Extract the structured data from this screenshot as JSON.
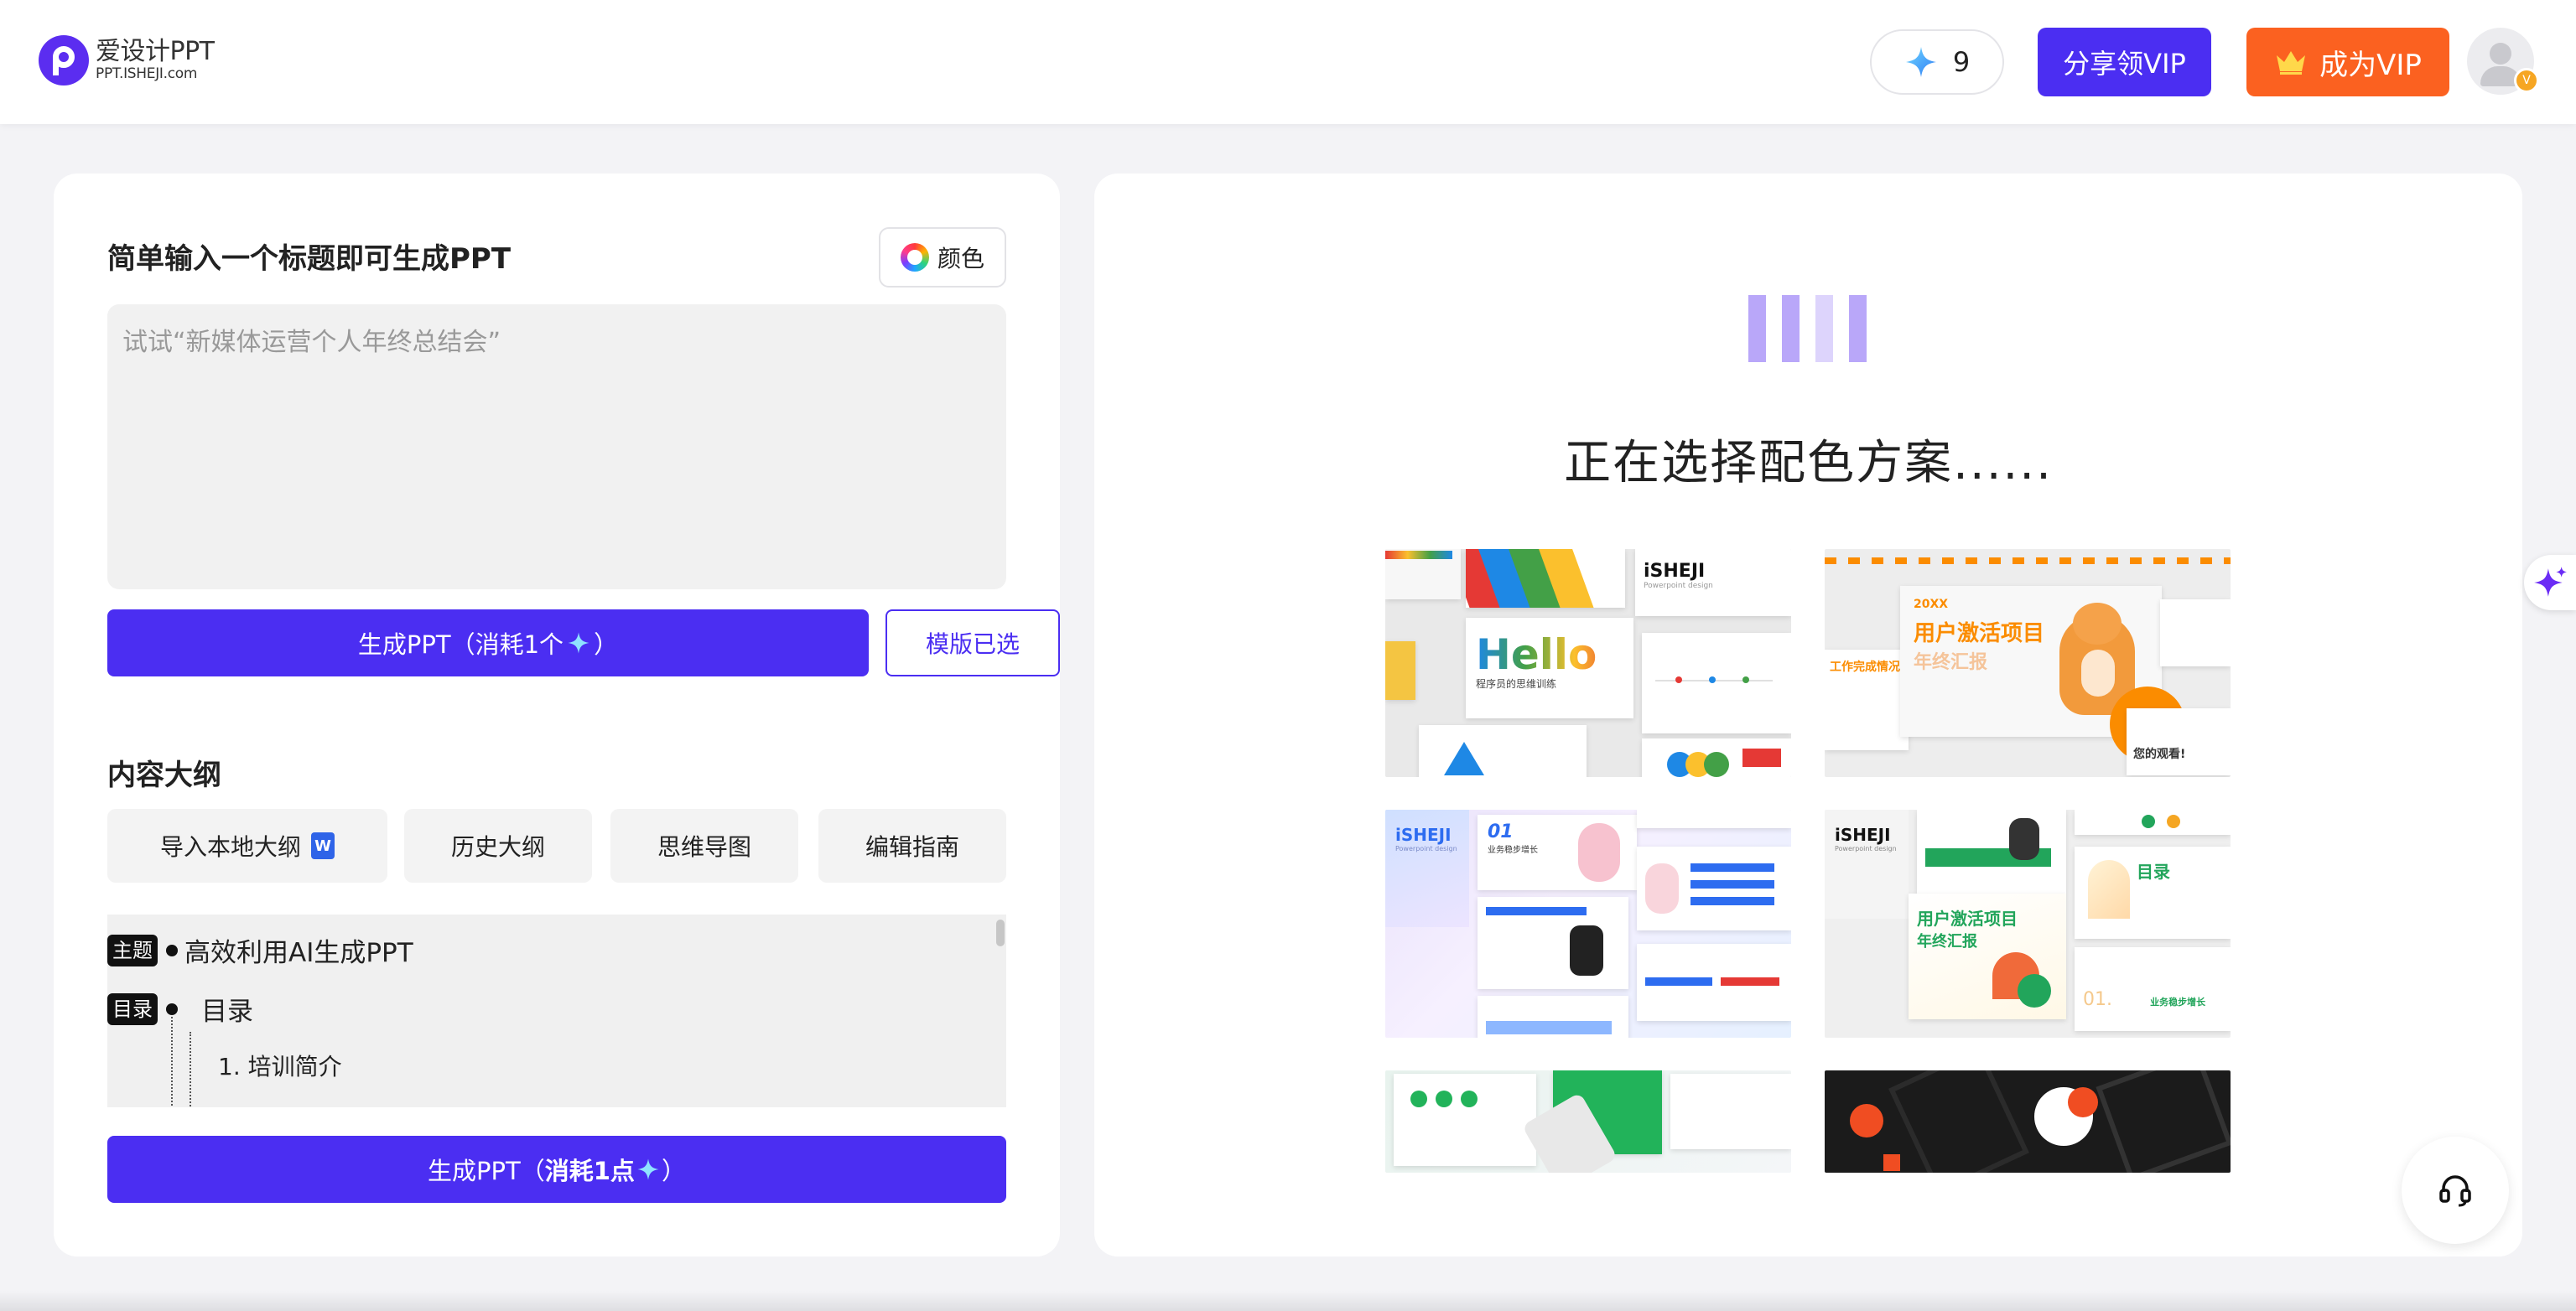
{
  "header": {
    "logo_name": "爱设计PPT",
    "logo_sub": "PPT.ISHEJI.com",
    "credits": "9",
    "share_label": "分享领VIP",
    "vip_label": "成为VIP",
    "avatar_badge": "V"
  },
  "left": {
    "title": "简单输入一个标题即可生成PPT",
    "color_label": "颜色",
    "input_placeholder": "试试“新媒体运营个人年终总结会”",
    "input_value": "",
    "generate_label": "生成PPT（消耗1个",
    "generate_suffix": "）",
    "template_label": "模版已选",
    "outline_title": "内容大纲",
    "tools": [
      "导入本地大纲",
      "历史大纲",
      "思维导图",
      "编辑指南"
    ],
    "outline": {
      "tag_topic": "主题",
      "topic": "高效利用AI生成PPT",
      "tag_toc": "目录",
      "toc": "目录",
      "item1": "1. 培训简介"
    },
    "generate2_prefix": "生成PPT（",
    "generate2_bold": "消耗1点",
    "generate2_suffix": "）"
  },
  "right": {
    "status": "正在选择配色方案......",
    "thumb1": {
      "brand": "iSHEJI",
      "brand_sub": "Powerpoint design",
      "hello": "Hello",
      "hello_sub": "程序员的思维训练"
    },
    "thumb2": {
      "year": "20XX",
      "title": "用户激活项目",
      "subtitle": "年终汇报",
      "left_text": "工作完成情况",
      "thanks": "您的观看!"
    },
    "thumb3": {
      "brand": "iSHEJI",
      "brand_sub": "Powerpoint design",
      "num": "01",
      "label": "业务稳步增长"
    },
    "thumb4": {
      "brand": "iSHEJI",
      "brand_sub": "Powerpoint design",
      "title": "用户激活项目",
      "subtitle": "年终汇报",
      "toc": "目录",
      "num": "01.",
      "label": "业务稳步增长"
    }
  },
  "colors": {
    "primary": "#4b2ef2",
    "vip_orange": "#fb6120",
    "loader_bar": "#b9a7f9",
    "background": "#f3f3f6"
  },
  "icons": [
    "sparkle-icon",
    "crown-icon",
    "avatar-icon",
    "color-wheel-icon",
    "word-doc-icon",
    "ai-sparkle-icon",
    "headset-icon"
  ]
}
